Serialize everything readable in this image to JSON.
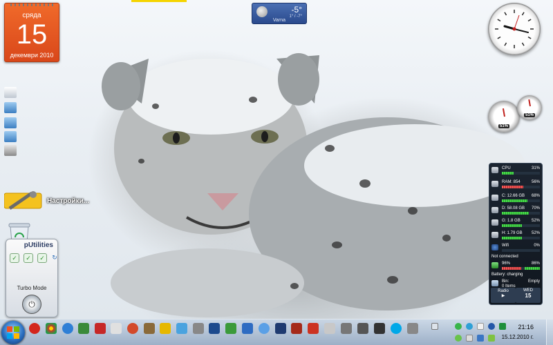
{
  "calendar": {
    "day_of_week": "сряда",
    "day": "15",
    "month_year": "декември 2010"
  },
  "weather": {
    "temperature": "-5°",
    "range": "1° / -7°",
    "city": "Varna"
  },
  "settings": {
    "label": "Настройки..."
  },
  "utilities": {
    "title": "pUtilities",
    "turbo_label": "Turbo Mode",
    "checks": [
      "✓",
      "✓",
      "✓"
    ],
    "refresh": "↻",
    "power": "⏻"
  },
  "sysmon": {
    "cpu": {
      "label": "CPU",
      "pct": "31%",
      "value": 31
    },
    "ram": {
      "label": "RAM: 854",
      "pct": "56%",
      "value": 56
    },
    "drives": [
      {
        "label": "C:",
        "size": "12.66 GB",
        "pct": "68%",
        "value": 68
      },
      {
        "label": "D:",
        "size": "58.08 GB",
        "pct": "70%",
        "value": 70
      },
      {
        "label": "G:",
        "size": "1.8 GB",
        "pct": "52%",
        "value": 52
      },
      {
        "label": "H:",
        "size": "1.79 GB",
        "pct": "52%",
        "value": 52
      }
    ],
    "wifi": {
      "label": "Wifi",
      "pct": "0%",
      "status": "Not connected"
    },
    "battery": {
      "left_pct": "96%",
      "right_pct": "86%",
      "status": "Battery: charging"
    },
    "bin": {
      "label": "Bin:",
      "items": "0 Items",
      "state": "Empty"
    },
    "radio": {
      "label": "Radio",
      "play": "▶"
    },
    "date": {
      "dow": "WED",
      "day": "15"
    }
  },
  "meters": {
    "cpu_value": "51%",
    "ram_value": "51%"
  },
  "taskbar": {
    "time": "21:16",
    "date": "15.12.2010 г."
  },
  "colors": {
    "calendar": "#e4562a",
    "weather": "#34589c",
    "taskbar": "#a8bcd4",
    "sysmon": "#151c26",
    "bar_green": "#46d84a",
    "bar_red": "#f05a5a"
  }
}
